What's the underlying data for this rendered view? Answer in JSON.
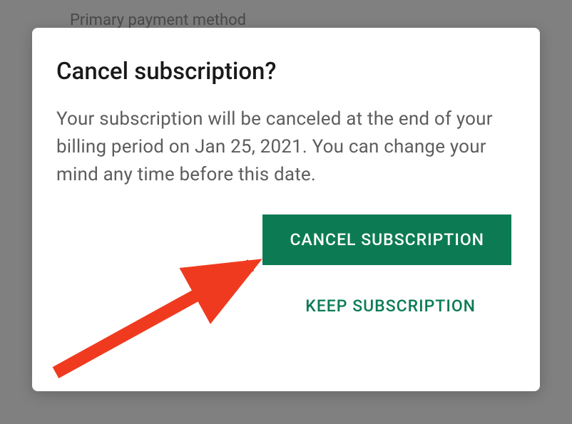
{
  "background": {
    "header_text": "Primary payment method"
  },
  "dialog": {
    "title": "Cancel subscription?",
    "body": "Your subscription will be canceled at the end of your billing period on Jan 25, 2021. You can change your mind any time before this date.",
    "buttons": {
      "primary": "CANCEL SUBSCRIPTION",
      "secondary": "KEEP SUBSCRIPTION"
    }
  },
  "annotation": {
    "arrow_color": "#f03a1f"
  }
}
